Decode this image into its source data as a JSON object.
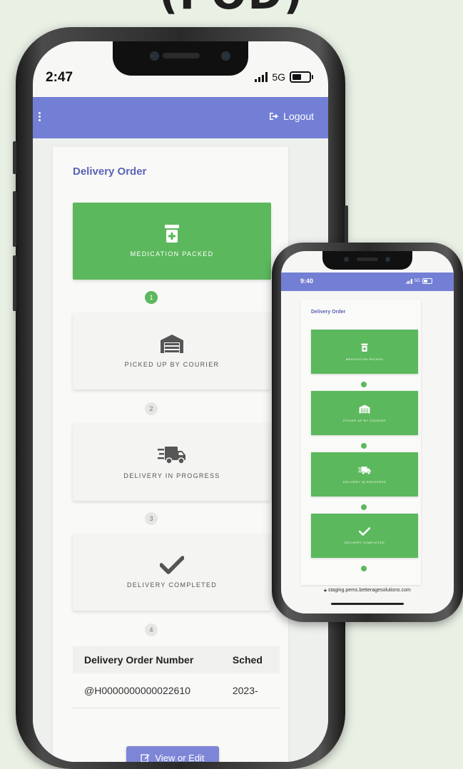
{
  "headline": "(POD)",
  "big_phone": {
    "status": {
      "time": "2:47",
      "network": "5G"
    },
    "appbar": {
      "logout_label": "Logout"
    },
    "card_title": "Delivery Order",
    "steps": [
      {
        "label": "MEDICATION PACKED",
        "icon": "pill-bottle-icon",
        "state": "active",
        "number": "1"
      },
      {
        "label": "PICKED UP BY COURIER",
        "icon": "warehouse-icon",
        "state": "inactive",
        "number": "2"
      },
      {
        "label": "DELIVERY IN PROGRESS",
        "icon": "truck-icon",
        "state": "inactive",
        "number": "3"
      },
      {
        "label": "DELIVERY COMPLETED",
        "icon": "checkmark-icon",
        "state": "inactive",
        "number": "4"
      }
    ],
    "table": {
      "headers": [
        "Delivery Order Number",
        "Sched"
      ],
      "rows": [
        [
          "@H0000000000022610",
          "2023-"
        ]
      ]
    },
    "view_button_label": "View or Edit"
  },
  "small_phone": {
    "status": {
      "time": "9:40",
      "network": "5G"
    },
    "card_title": "Delivery Order",
    "steps": [
      {
        "label": "MEDICATION PACKED",
        "icon": "pill-bottle-icon"
      },
      {
        "label": "PICKED UP BY COURIER",
        "icon": "warehouse-icon"
      },
      {
        "label": "DELIVERY IN PROGRESS",
        "icon": "truck-icon"
      },
      {
        "label": "DELIVERY COMPLETED",
        "icon": "checkmark-icon"
      }
    ],
    "url": "staging.pems.betteragesolutions.com"
  },
  "colors": {
    "accent": "#737fd4",
    "step_active": "#5cb85c",
    "title": "#5b63b5",
    "background": "#e9f0e4"
  }
}
